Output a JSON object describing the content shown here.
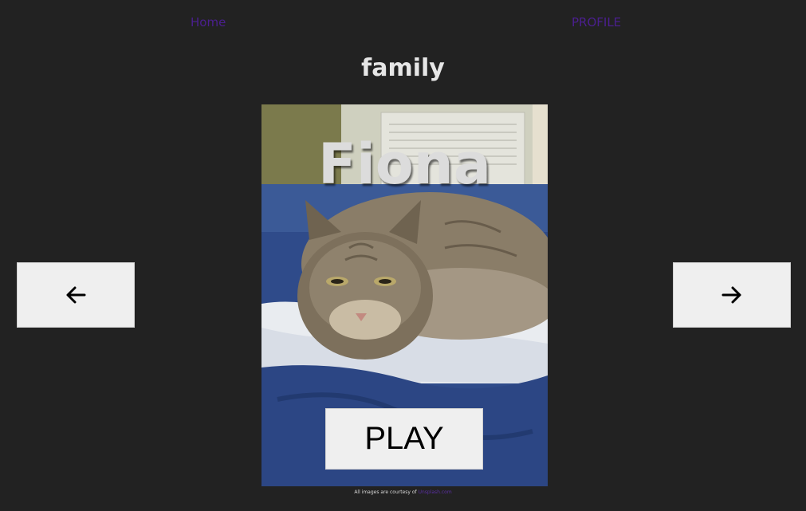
{
  "nav": {
    "home_label": "Home",
    "profile_label": "PROFILE"
  },
  "collection": {
    "title": "family"
  },
  "card": {
    "name": "Fiona",
    "play_label": "PLAY"
  },
  "controls": {
    "prev_icon": "arrow-left-icon",
    "next_icon": "arrow-right-icon"
  },
  "footer": {
    "credit_text": "All images are courtesy of",
    "credit_link": "Unsplash.com"
  },
  "colors": {
    "background": "#222222",
    "nav_link": "#4b1f8f",
    "button_bg": "#efefef"
  }
}
